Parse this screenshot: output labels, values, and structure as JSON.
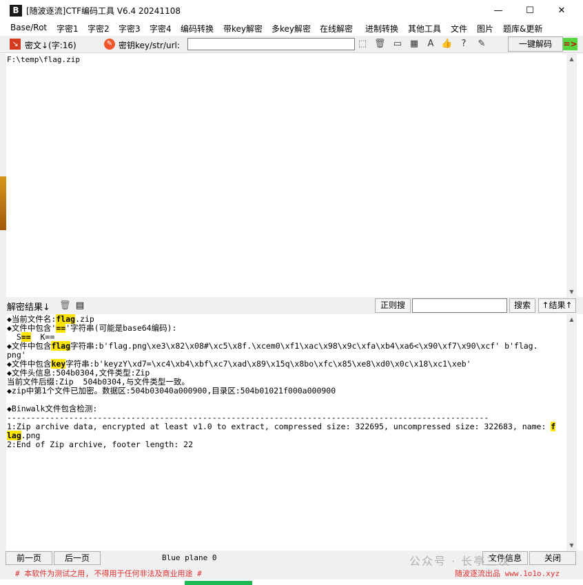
{
  "window": {
    "icon_text": "B",
    "title": "[随波逐流]CTF编码工具 V6.4 20241108",
    "minimize_glyph": "—",
    "maximize_glyph": "☐",
    "close_glyph": "✕"
  },
  "menu": [
    "Base/Rot",
    "字密1",
    "字密2",
    "字密3",
    "字密4",
    "编码转换",
    "带key解密",
    "多key解密",
    "在线解密",
    "进制转换",
    "其他工具",
    "文件",
    "图片",
    "题库&更新"
  ],
  "toolbar": {
    "cipher_label": "密文↓(字:16)",
    "key_label": "密钥key/str/url:",
    "key_value": "",
    "decode_button": "一键解码",
    "arrow_button": "=>"
  },
  "input": {
    "text": "F:\\temp\\flag.zip"
  },
  "result_bar": {
    "label": "解密结果↓",
    "regex_button": "正则搜",
    "search_value": "",
    "search_button": "搜索",
    "toggle_button": "↑结果↑"
  },
  "output": {
    "lines": [
      [
        {
          "t": "◆当前文件名:"
        },
        {
          "t": "flag",
          "h": true
        },
        {
          "t": ".zip"
        }
      ],
      [
        {
          "t": "◆文件中包含'"
        },
        {
          "t": "==",
          "h": true
        },
        {
          "t": "'字符串(可能是base64编码):"
        }
      ],
      [
        {
          "t": "  S"
        },
        {
          "t": "==",
          "h": true
        },
        {
          "t": "  K=="
        }
      ],
      [
        {
          "t": "◆文件中包含"
        },
        {
          "t": "flag",
          "h": true
        },
        {
          "t": "字符串:b'flag.png\\xe3\\x82\\x08#\\xc5\\x8f.\\xcem0\\xf1\\xac\\x98\\x9c\\xfa\\xb4\\xa6<\\x90\\xf7\\x90\\xcf' b'flag."
        }
      ],
      [
        {
          "t": "png'"
        }
      ],
      [
        {
          "t": "◆文件中包含"
        },
        {
          "t": "key",
          "h": true
        },
        {
          "t": "字符串:b'keyzY\\xd7=\\xc4\\xb4\\xbf\\xc7\\xad\\x89\\x15q\\x8bo\\xfc\\x85\\xe8\\xd0\\x0c\\x18\\xc1\\xeb'"
        }
      ],
      [
        {
          "t": "◆文件头信息:504b0304,文件类型:Zip"
        }
      ],
      [
        {
          "t": "当前文件后缀:Zip  504b0304,与文件类型一致。"
        }
      ],
      [
        {
          "t": "◆zip中第1个文件已加密。数据区:504b03040a000900,目录区:504b01021f000a000900"
        }
      ],
      [
        {
          "t": ""
        }
      ],
      [
        {
          "t": "◆Binwalk文件包含检测:"
        }
      ],
      [
        {
          "t": "-----------------------------------------------------------------------------------------------------"
        }
      ],
      [
        {
          "t": "1:Zip archive data, encrypted at least v1.0 to extract, compressed size: 322695, uncompressed size: 322683, name: "
        },
        {
          "t": "f",
          "h": true
        }
      ],
      [
        {
          "t": "lag",
          "h": true
        },
        {
          "t": ".png"
        }
      ],
      [
        {
          "t": "2:End of Zip archive, footer length: 22"
        }
      ]
    ]
  },
  "bottom": {
    "prev_button": "前一页",
    "next_button": "后一页",
    "plane_label": "Blue plane 0",
    "file_info_button": "文件信息",
    "close_button": "关闭",
    "watermark": "公众号 · 长亭三次"
  },
  "footer": {
    "disclaimer": "# 本软件为测试之用, 不得用于任何非法及商业用途 #",
    "brand": "随波逐流出品 www.1o1o.xyz"
  }
}
